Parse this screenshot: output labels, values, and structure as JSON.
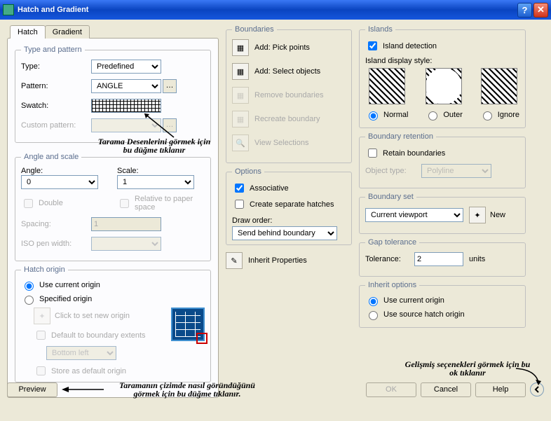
{
  "window": {
    "title": "Hatch and Gradient"
  },
  "tabs": {
    "hatch": "Hatch",
    "gradient": "Gradient"
  },
  "typePattern": {
    "legend": "Type and pattern",
    "typeLbl": "Type:",
    "typeVal": "Predefined",
    "patternLbl": "Pattern:",
    "patternVal": "ANGLE",
    "swatchLbl": "Swatch:",
    "customLbl": "Custom pattern:"
  },
  "annot": {
    "swatch": "Tarama Desenlerini görmek için bu düğme tıklanır",
    "preview": "Taramanın çizimde nasıl göründüğünü görmek için bu düğme tıklanır.",
    "advanced": "Gelişmiş seçenekleri görmek için bu ok tıklanır"
  },
  "angleScale": {
    "legend": "Angle and scale",
    "angleLbl": "Angle:",
    "angleVal": "0",
    "scaleLbl": "Scale:",
    "scaleVal": "1",
    "double": "Double",
    "relative": "Relative to paper space",
    "spacing": "Spacing:",
    "spacingVal": "1",
    "iso": "ISO pen width:"
  },
  "hatchOrigin": {
    "legend": "Hatch origin",
    "useCurrent": "Use current origin",
    "specified": "Specified origin",
    "clickSet": "Click to set new origin",
    "defaultExt": "Default to boundary extents",
    "bottomLeft": "Bottom left",
    "store": "Store as default origin"
  },
  "previewBtn": "Preview",
  "boundaries": {
    "legend": "Boundaries",
    "pick": "Add: Pick points",
    "select": "Add: Select objects",
    "remove": "Remove boundaries",
    "recreate": "Recreate boundary",
    "view": "View Selections"
  },
  "options": {
    "legend": "Options",
    "associative": "Associative",
    "separate": "Create separate hatches",
    "drawOrderLbl": "Draw order:",
    "drawOrderVal": "Send behind boundary"
  },
  "inheritProps": "Inherit Properties",
  "islands": {
    "legend": "Islands",
    "detection": "Island detection",
    "displayStyle": "Island display style:",
    "normal": "Normal",
    "outer": "Outer",
    "ignore": "Ignore"
  },
  "boundaryRetention": {
    "legend": "Boundary retention",
    "retain": "Retain boundaries",
    "objTypeLbl": "Object type:",
    "objTypeVal": "Polyline"
  },
  "boundarySet": {
    "legend": "Boundary set",
    "val": "Current viewport",
    "new": "New"
  },
  "gap": {
    "legend": "Gap tolerance",
    "tolLbl": "Tolerance:",
    "tolVal": "2",
    "units": "units"
  },
  "inheritOptions": {
    "legend": "Inherit options",
    "useCurrent": "Use current origin",
    "useSource": "Use source hatch origin"
  },
  "buttons": {
    "ok": "OK",
    "cancel": "Cancel",
    "help": "Help"
  }
}
